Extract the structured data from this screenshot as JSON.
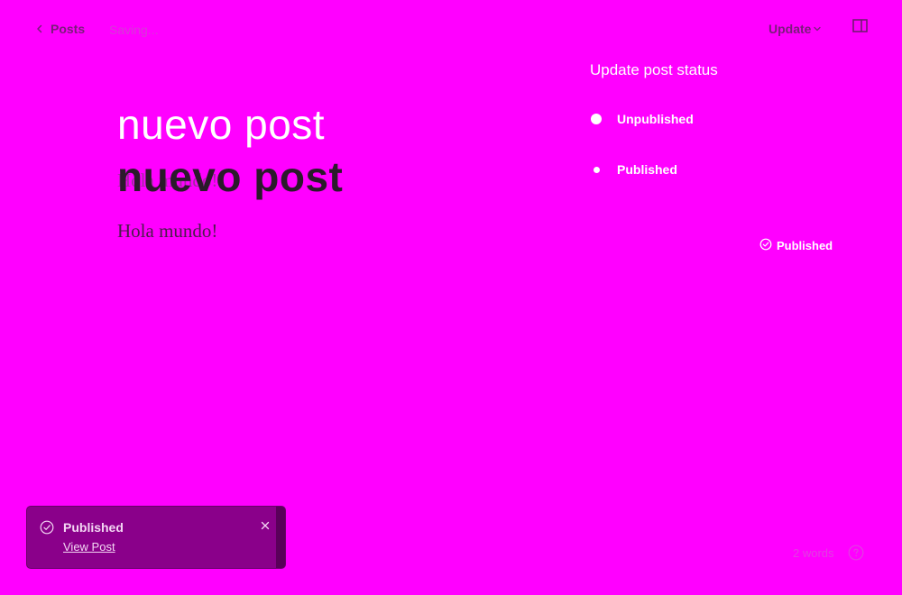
{
  "topbar": {
    "back_label": "Posts",
    "saving_text": "Saving...",
    "update_label": "Update"
  },
  "editor": {
    "title_ghost": "nuevo post",
    "title": "nuevo post",
    "body_ghost": "Hola mundo!",
    "body": "Hola mundo!"
  },
  "status_panel": {
    "title": "Update post status",
    "options": [
      {
        "label": "Unpublished"
      },
      {
        "label": "Published"
      }
    ],
    "current_status": "Published"
  },
  "toast": {
    "title": "Published",
    "link": "View Post"
  },
  "footer": {
    "word_count": "2 words"
  },
  "icons": {
    "back": "chevron-left-icon",
    "update": "chevron-down-icon",
    "sidebar": "sidebar-toggle-icon",
    "status": "check-circle-icon",
    "toast_check": "check-circle-icon",
    "toast_close": "close-icon",
    "help": "help-icon"
  },
  "colors": {
    "background": "#ff00ff",
    "toast_bg": "#8a008a",
    "text_dark": "#2b1a2b",
    "text_light": "#ffffff"
  }
}
